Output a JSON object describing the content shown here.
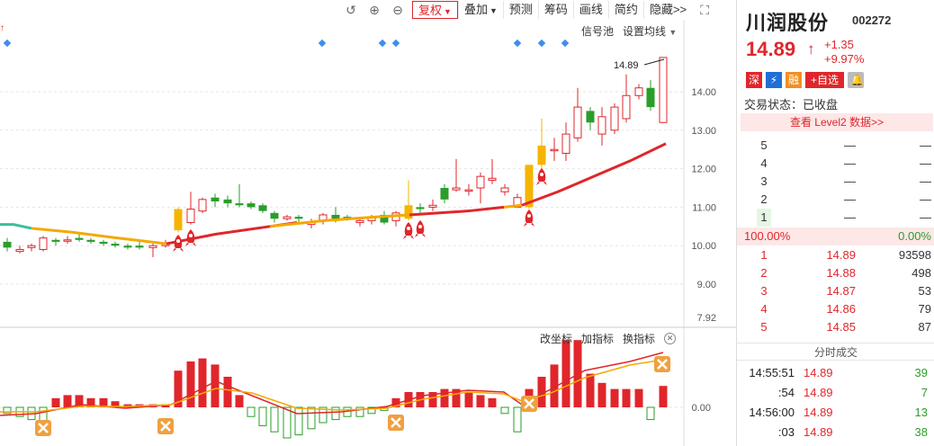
{
  "toolbar": {
    "fuquan": "复权",
    "diejia": "叠加",
    "yuce": "预测",
    "chouma": "筹码",
    "huaxian": "画线",
    "jianyue": "简约",
    "yincang": "隐藏>>"
  },
  "signal": {
    "signal_pool": "信号池",
    "set_ma": "设置均线"
  },
  "sub_indicator": {
    "change_coord": "改坐标",
    "add_indicator": "加指标",
    "switch_indicator": "换指标"
  },
  "chart": {
    "last_price_label": "14.89",
    "low_label": "7.92",
    "price_ticks": [
      {
        "value": 14,
        "label": "14.00"
      },
      {
        "value": 13,
        "label": "13.00"
      },
      {
        "value": 12,
        "label": "12.00"
      },
      {
        "value": 11,
        "label": "11.00"
      },
      {
        "value": 10,
        "label": "10.00"
      },
      {
        "value": 9,
        "label": "9.00"
      }
    ],
    "sub_tick": "0.00",
    "colors": {
      "up": "#e0262b",
      "down": "#2a9d2a",
      "ma_main": "#e0262b",
      "ma_gold": "#f5a800",
      "ma_teal": "#3cbf9a",
      "signal_diamond": "#3c8ef0",
      "rocket": "#e0262b",
      "x_badge": "#f0a040"
    }
  },
  "panel": {
    "name": "川润股份",
    "code": "002272",
    "price": "14.89",
    "arrow": "↑",
    "change": "+1.35",
    "change_pct": "+9.97%",
    "badges": {
      "market": "深",
      "lightning": "⚡",
      "margin": "融",
      "watchlist": "+自选",
      "bell": "🔔"
    },
    "status": "交易状态：已收盘",
    "level2": "查看 Level2 数据>>",
    "sell_rows": [
      {
        "level": "5",
        "price": "—",
        "volume": "—"
      },
      {
        "level": "4",
        "price": "—",
        "volume": "—"
      },
      {
        "level": "3",
        "price": "—",
        "volume": "—"
      },
      {
        "level": "2",
        "price": "—",
        "volume": "—"
      },
      {
        "level": "1",
        "price": "—",
        "volume": "—"
      }
    ],
    "ratio_left": "100.00%",
    "ratio_right": "0.00%",
    "buy_rows": [
      {
        "level": "1",
        "price": "14.89",
        "volume": "93598"
      },
      {
        "level": "2",
        "price": "14.88",
        "volume": "498"
      },
      {
        "level": "3",
        "price": "14.87",
        "volume": "53"
      },
      {
        "level": "4",
        "price": "14.86",
        "volume": "79"
      },
      {
        "level": "5",
        "price": "14.85",
        "volume": "87"
      }
    ],
    "ticks_title": "分时成交",
    "ticks": [
      {
        "time": "14:55:51",
        "price": "14.89",
        "volume": "39"
      },
      {
        "time": ":54",
        "price": "14.89",
        "volume": "7"
      },
      {
        "time": "14:56:00",
        "price": "14.89",
        "volume": "13"
      },
      {
        "time": ":03",
        "price": "14.89",
        "volume": "38"
      }
    ]
  }
}
